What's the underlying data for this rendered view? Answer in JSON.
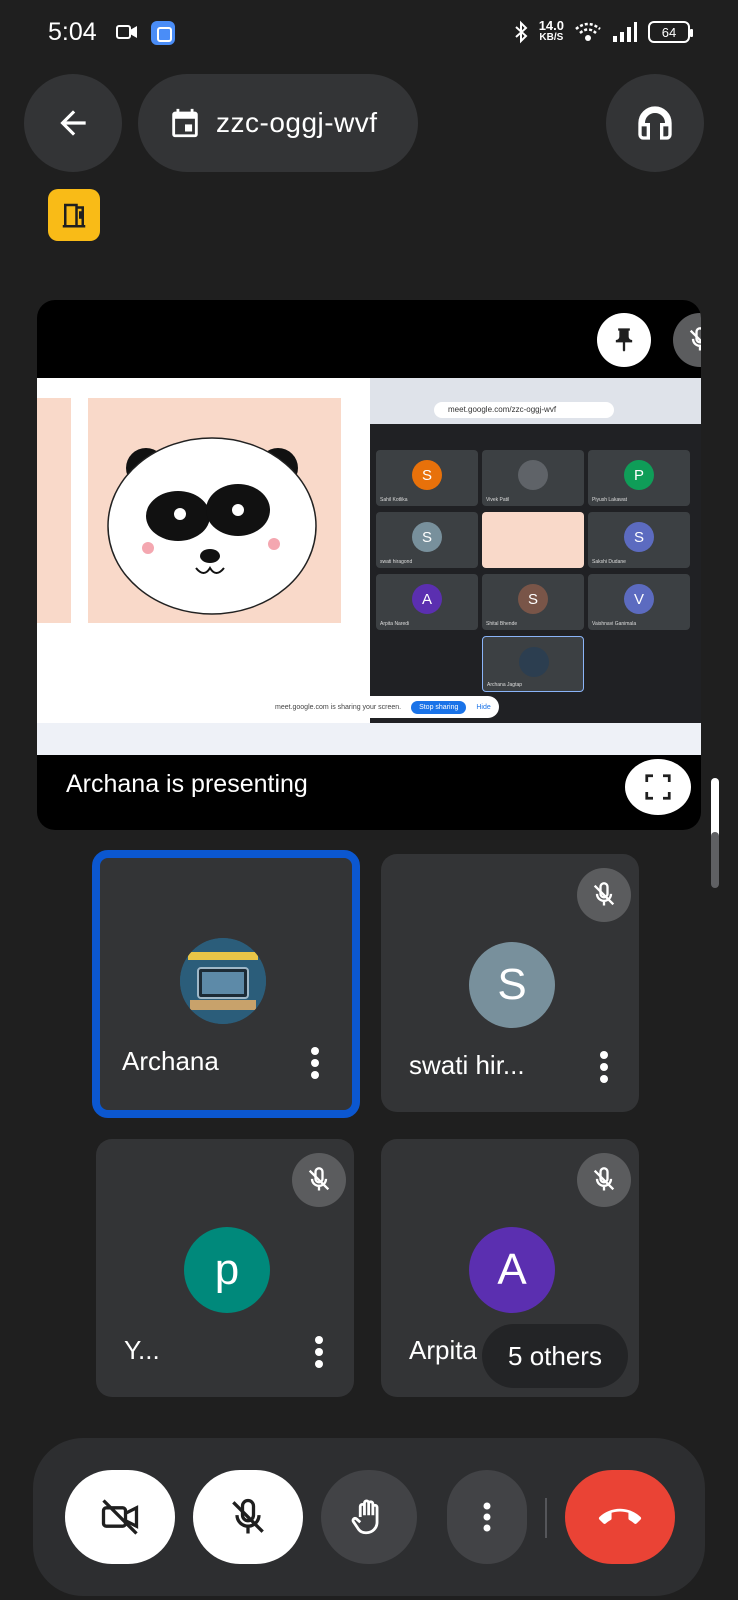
{
  "status_bar": {
    "time": "5:04",
    "net_speed": "14.0",
    "net_unit": "KB/S",
    "battery": "64"
  },
  "top_bar": {
    "meeting_code": "zzc-oggj-wvf"
  },
  "presentation": {
    "label": "Archana is presenting",
    "shared_screen": {
      "url": "meet.google.com/zzc-oggj-wvf",
      "sharing_notice": "meet.google.com is sharing your screen.",
      "stop_sharing": "Stop sharing",
      "hide": "Hide",
      "tiles": [
        {
          "initial": "S",
          "name": "Sahil Kotlika",
          "color": "#e8710a"
        },
        {
          "initial": "",
          "name": "Vivek Patil",
          "color": "#5f6368"
        },
        {
          "initial": "P",
          "name": "Piyush Lakawat",
          "color": "#0f9d58"
        },
        {
          "initial": "S",
          "name": "swati hiragond",
          "color": "#78909c"
        },
        {
          "initial": "",
          "name": "",
          "color": "#ffffff"
        },
        {
          "initial": "S",
          "name": "Sakshi Dudane",
          "color": "#5c6bc0"
        },
        {
          "initial": "A",
          "name": "Arpita Naredi",
          "color": "#5b2fb0"
        },
        {
          "initial": "S",
          "name": "Shital Bhende",
          "color": "#795548"
        },
        {
          "initial": "V",
          "name": "Vaishnavi Ganimala",
          "color": "#5c6bc0"
        },
        {
          "initial": "",
          "name": "Archana Jagtap",
          "color": "#2c3e50"
        }
      ]
    }
  },
  "participants": [
    {
      "name": "Archana",
      "initial": "",
      "color": "#2b5d7a",
      "muted": false,
      "active": true
    },
    {
      "name": "swati hir...",
      "initial": "S",
      "color": "#78909c",
      "muted": true,
      "active": false
    },
    {
      "name": "Y...",
      "initial": "p",
      "color": "#00897b",
      "muted": true,
      "active": false
    },
    {
      "name": "Arpita",
      "initial": "A",
      "color": "#5b2fb0",
      "muted": true,
      "active": false
    }
  ],
  "others_label": "5 others",
  "colors": {
    "background": "#1f1f1f",
    "tile": "#333436",
    "active_border": "#0b57d0",
    "end_call": "#ea4335",
    "ext_badge": "#f9bb17"
  },
  "icons": {
    "back": "arrow-back-icon",
    "calendar": "calendar-icon",
    "audio": "headphones-icon",
    "pin": "pin-icon",
    "mic_off": "mic-off-icon",
    "fullscreen": "fullscreen-icon",
    "more": "more-vert-icon",
    "camera_off": "videocam-off-icon",
    "hand": "raise-hand-icon",
    "end_call": "call-end-icon"
  }
}
